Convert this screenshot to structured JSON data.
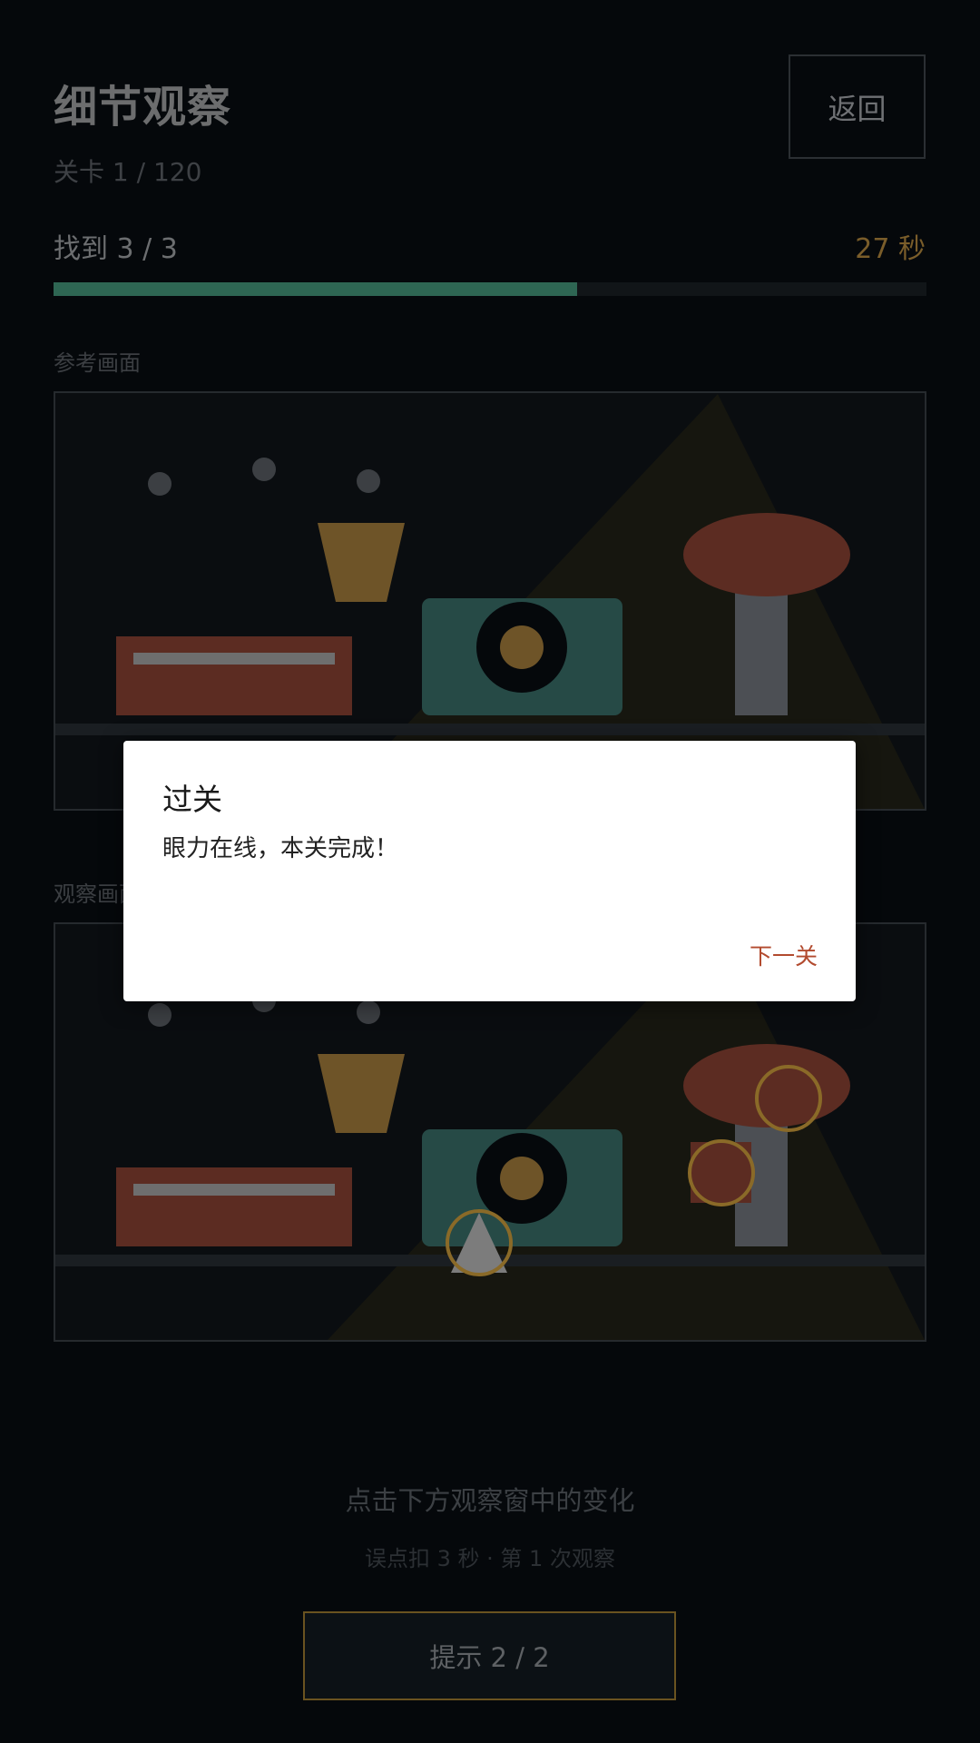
{
  "header": {
    "title": "细节观察",
    "level": "关卡 1 / 120",
    "back_label": "返回"
  },
  "status": {
    "found": "找到 3 / 3",
    "timer": "27 秒",
    "progress_fraction": 0.6
  },
  "reference": {
    "label": "参考画面"
  },
  "observe": {
    "label": "观察画面"
  },
  "footer": {
    "instruction": "点击下方观察窗中的变化",
    "detail": "误点扣 3 秒 · 第 1 次观察",
    "hint_label": "提示  2 / 2"
  },
  "dialog": {
    "title": "过关",
    "message": "眼力在线，本关完成！",
    "next_label": "下一关"
  },
  "colors": {
    "accent_green": "#2e6653",
    "timer_amber": "#7a5d2a",
    "brick_red": "#5c2c22",
    "teal": "#264a46",
    "ochre": "#6e5428",
    "marker_gold": "#8a6a28",
    "next_red": "#b24a2e"
  }
}
